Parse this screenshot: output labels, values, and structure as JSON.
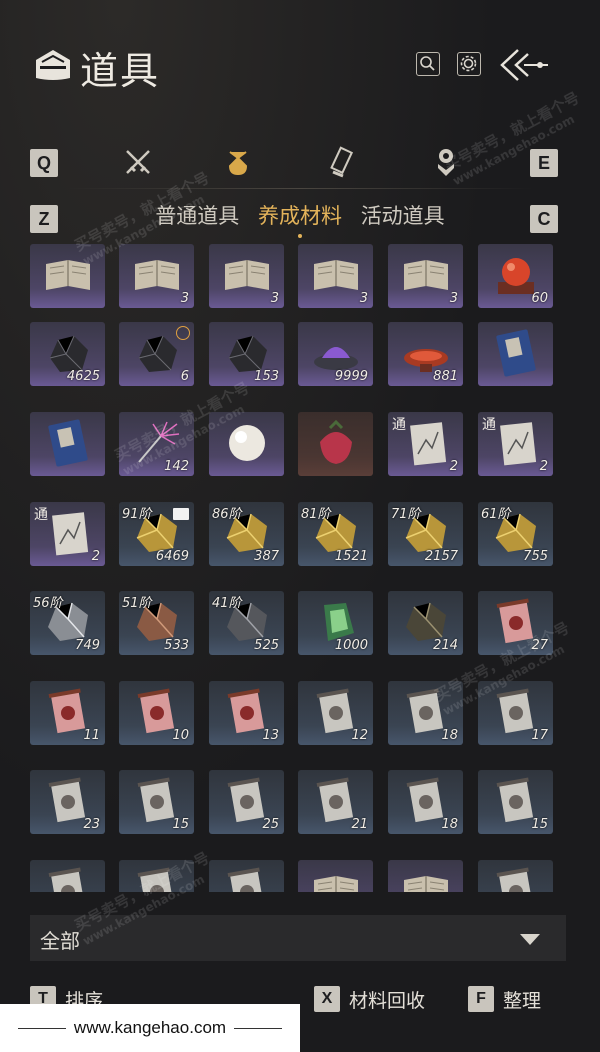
{
  "header": {
    "title": "道具",
    "icons": [
      "bag-icon",
      "search-icon",
      "gear-icon",
      "back-arrow-icon"
    ]
  },
  "category_tabs": {
    "prev_key": "Q",
    "next_key": "E",
    "icons": [
      "crossed-swords-icon",
      "pouch-icon",
      "scroll-icon",
      "gem-tree-icon"
    ],
    "active_index": 1
  },
  "subtabs": {
    "prev_key": "Z",
    "next_key": "C",
    "items": [
      "普通道具",
      "养成材料",
      "活动道具"
    ],
    "active_index": 1
  },
  "grid": {
    "rows": [
      [
        {
          "icon": "book-icon",
          "count": ""
        },
        {
          "icon": "book-icon",
          "count": "3"
        },
        {
          "icon": "book-icon",
          "count": "3"
        },
        {
          "icon": "book-icon",
          "count": "3"
        },
        {
          "icon": "book-icon",
          "count": "3"
        },
        {
          "icon": "red-orb-icon",
          "count": "60"
        }
      ],
      [
        {
          "icon": "black-ore-icon",
          "count": "4625"
        },
        {
          "icon": "black-ore-icon",
          "count": "6"
        },
        {
          "icon": "black-ore-icon",
          "count": "153"
        },
        {
          "icon": "purple-dish-icon",
          "count": "9999"
        },
        {
          "icon": "red-dish-icon",
          "count": "881"
        },
        {
          "icon": "blue-book-icon",
          "count": ""
        }
      ],
      [
        {
          "icon": "blue-book-icon",
          "count": ""
        },
        {
          "icon": "feather-icon",
          "count": "142"
        },
        {
          "icon": "pearl-icon",
          "count": ""
        },
        {
          "icon": "red-fruit-icon",
          "count": ""
        },
        {
          "icon": "manual-icon",
          "count": "2",
          "tong": "通"
        },
        {
          "icon": "manual-icon",
          "count": "2",
          "tong": "通"
        }
      ],
      [
        {
          "icon": "manual-icon",
          "count": "2",
          "tong": "通"
        },
        {
          "icon": "gold-ore-icon",
          "count": "6469",
          "tier": "91阶",
          "badge": true
        },
        {
          "icon": "gold-ore-icon",
          "count": "387",
          "tier": "86阶"
        },
        {
          "icon": "gold-ore-icon",
          "count": "1521",
          "tier": "81阶"
        },
        {
          "icon": "gold-ore-icon",
          "count": "2157",
          "tier": "71阶"
        },
        {
          "icon": "gold-ore-icon",
          "count": "755",
          "tier": "61阶"
        }
      ],
      [
        {
          "icon": "silver-ore-icon",
          "count": "749",
          "tier": "56阶"
        },
        {
          "icon": "copper-ore-icon",
          "count": "533",
          "tier": "51阶"
        },
        {
          "icon": "iron-ore-icon",
          "count": "525",
          "tier": "41阶"
        },
        {
          "icon": "jade-icon",
          "count": "1000"
        },
        {
          "icon": "dark-ore-icon",
          "count": "214"
        },
        {
          "icon": "red-scroll-icon",
          "count": "27"
        }
      ],
      [
        {
          "icon": "red-scroll-icon",
          "count": "11"
        },
        {
          "icon": "red-scroll-icon",
          "count": "10"
        },
        {
          "icon": "red-scroll-icon",
          "count": "13"
        },
        {
          "icon": "grey-scroll-icon",
          "count": "12"
        },
        {
          "icon": "grey-scroll-icon",
          "count": "18"
        },
        {
          "icon": "grey-scroll-icon",
          "count": "17"
        }
      ],
      [
        {
          "icon": "grey-scroll-icon",
          "count": "23"
        },
        {
          "icon": "grey-scroll-icon",
          "count": "15"
        },
        {
          "icon": "grey-scroll-icon",
          "count": "25"
        },
        {
          "icon": "grey-scroll-icon",
          "count": "21"
        },
        {
          "icon": "grey-scroll-icon",
          "count": "18"
        },
        {
          "icon": "grey-scroll-icon",
          "count": "15"
        }
      ],
      [
        {
          "icon": "grey-scroll-icon",
          "count": ""
        },
        {
          "icon": "grey-scroll-icon",
          "count": ""
        },
        {
          "icon": "grey-scroll-icon",
          "count": ""
        },
        {
          "icon": "book-icon",
          "count": ""
        },
        {
          "icon": "book-icon",
          "count": ""
        },
        {
          "icon": "grey-scroll-icon",
          "count": ""
        }
      ]
    ]
  },
  "filter": {
    "label": "全部"
  },
  "actions": [
    {
      "key": "T",
      "label": "排序"
    },
    {
      "key": "X",
      "label": "材料回收"
    },
    {
      "key": "F",
      "label": "整理"
    }
  ],
  "watermarks": {
    "main": "买号卖号，就上看个号",
    "site": "www.kangehao.com",
    "brand": "看个号"
  },
  "footer": {
    "url": "www.kangehao.com"
  },
  "colors": {
    "accent": "#e3b35a",
    "background": "#1b1b1d",
    "keycap": "#c9c5bd"
  }
}
